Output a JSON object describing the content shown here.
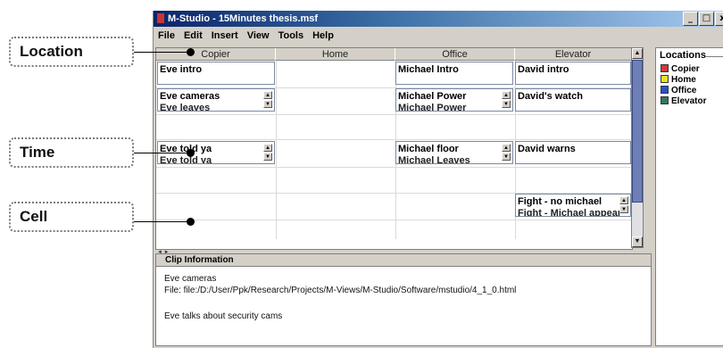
{
  "window": {
    "title": "M-Studio - 15Minutes thesis.msf",
    "min_label": "_",
    "max_label": "□",
    "close_label": "x"
  },
  "menu": [
    "File",
    "Edit",
    "Insert",
    "View",
    "Tools",
    "Help"
  ],
  "grid": {
    "columns": [
      "Copier",
      "Home",
      "Office",
      "Elevator"
    ],
    "clips": [
      {
        "t1": "Eve intro",
        "t2": ""
      },
      {
        "t1": "Eve cameras",
        "t2": "Eve leaves"
      },
      {
        "t1": "Eve told ya",
        "t2": "Eve told ya"
      },
      {
        "t1": "Michael Intro",
        "t2": ""
      },
      {
        "t1": "Michael Power",
        "t2": "Michael Power"
      },
      {
        "t1": "Michael floor",
        "t2": "Michael Leaves"
      },
      {
        "t1": "David intro",
        "t2": ""
      },
      {
        "t1": "David's watch",
        "t2": ""
      },
      {
        "t1": "David warns",
        "t2": ""
      },
      {
        "t1": "Fight - no michael",
        "t2": "Fight - Michael appear"
      }
    ]
  },
  "info": {
    "title": "Clip Information",
    "line1": "Eve cameras",
    "line2": "File: file:/D:/User/Ppk/Research/Projects/M-Views/M-Studio/Software/mstudio/4_1_0.html",
    "line3": "Eve talks about security cams"
  },
  "legend": {
    "title": "Locations",
    "items": [
      {
        "label": "Copier",
        "color": "#d03a3a"
      },
      {
        "label": "Home",
        "color": "#e8e02a"
      },
      {
        "label": "Office",
        "color": "#2a52c8"
      },
      {
        "label": "Elevator",
        "color": "#2f7a5a"
      }
    ]
  },
  "callouts": {
    "location": "Location",
    "time": "Time",
    "cell": "Cell"
  },
  "icons": {
    "spin_up": "▲",
    "spin_down": "▼",
    "scroll_up": "▲",
    "scroll_down": "▼",
    "hscroll": "◄ ►"
  }
}
